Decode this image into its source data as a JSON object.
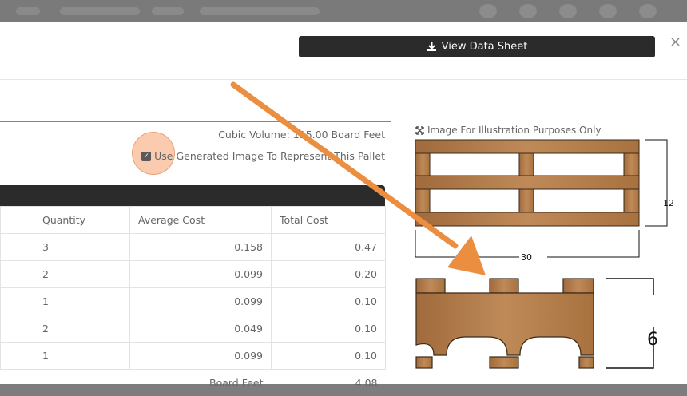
{
  "header": {
    "view_data_sheet_label": "View Data Sheet",
    "close_symbol": "×"
  },
  "summary": {
    "cubic_volume": "Cubic Volume: 115.00 Board Feet",
    "use_generated_image_label": "Use Generated Image To Represent This Pallet",
    "use_generated_image_checked": true
  },
  "table": {
    "headers": [
      "",
      "Quantity",
      "Average Cost",
      "Total Cost"
    ],
    "rows": [
      [
        "",
        "3",
        "0.158",
        "0.47"
      ],
      [
        "",
        "2",
        "0.099",
        "0.20"
      ],
      [
        "",
        "1",
        "0.099",
        "0.10"
      ],
      [
        "",
        "2",
        "0.049",
        "0.10"
      ],
      [
        "",
        "1",
        "0.099",
        "0.10"
      ]
    ],
    "footer_label": "Board Feet",
    "footer_value": "4.08"
  },
  "illustration": {
    "note": "Image For Illustration Purposes Only",
    "height_label": "12",
    "width_label": "30",
    "side_height_label": "6"
  },
  "icons": [
    "download-icon",
    "close-icon",
    "expand-icon",
    "checkbox-icon"
  ],
  "colors": {
    "dark_bar": "#2b2b2b",
    "wood": "#b07a4a",
    "annotation_arrow": "#ec8e3f"
  }
}
